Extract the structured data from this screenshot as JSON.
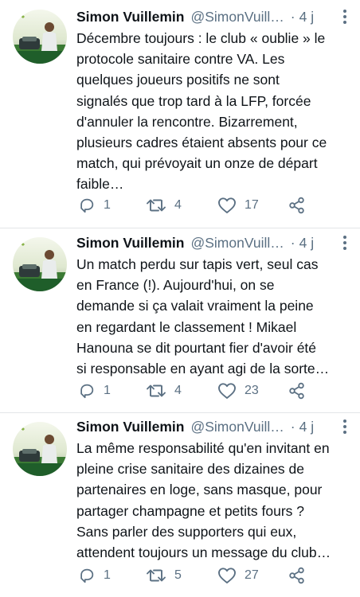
{
  "tweets": [
    {
      "author_name": "Simon Vuillemin",
      "handle": "@SimonVuill…",
      "separator": "·",
      "time": "4 j",
      "lines": [
        "Décembre toujours : le club « oublie » le",
        "protocole sanitaire contre VA. Les",
        "quelques joueurs positifs ne sont",
        "signalés que trop tard à la LFP, forcée",
        "d'annuler la rencontre. Bizarrement,",
        "plusieurs cadres étaient absents pour ce",
        "match, qui prévoyait un onze de départ",
        "faible…"
      ],
      "replies": "1",
      "retweets": "4",
      "likes": "17"
    },
    {
      "author_name": "Simon Vuillemin",
      "handle": "@SimonVuill…",
      "separator": "·",
      "time": "4 j",
      "lines": [
        "Un match perdu sur tapis vert, seul cas",
        "en France (!). Aujourd'hui, on se",
        "demande si ça valait vraiment la peine",
        "en regardant le classement ! Mikael",
        "Hanouna se dit pourtant fier d'avoir été",
        "si responsable en ayant agi de la sorte…"
      ],
      "replies": "1",
      "retweets": "4",
      "likes": "23"
    },
    {
      "author_name": "Simon Vuillemin",
      "handle": "@SimonVuill…",
      "separator": "·",
      "time": "4 j",
      "lines": [
        "La même responsabilité qu'en invitant en",
        "pleine crise sanitaire des dizaines de",
        "partenaires en loge, sans masque, pour",
        "partager champagne et petits fours ?",
        "Sans parler des supporters qui eux,",
        "attendent toujours un message du club…"
      ],
      "replies": "1",
      "retweets": "5",
      "likes": "27"
    }
  ],
  "icons": {
    "reply": "reply-icon",
    "retweet": "retweet-icon",
    "like": "like-icon",
    "share": "share-icon",
    "more": "more-vertical-icon"
  },
  "colors": {
    "text": "#0f1419",
    "secondary": "#5b7083",
    "divider": "#e3e6e8"
  }
}
